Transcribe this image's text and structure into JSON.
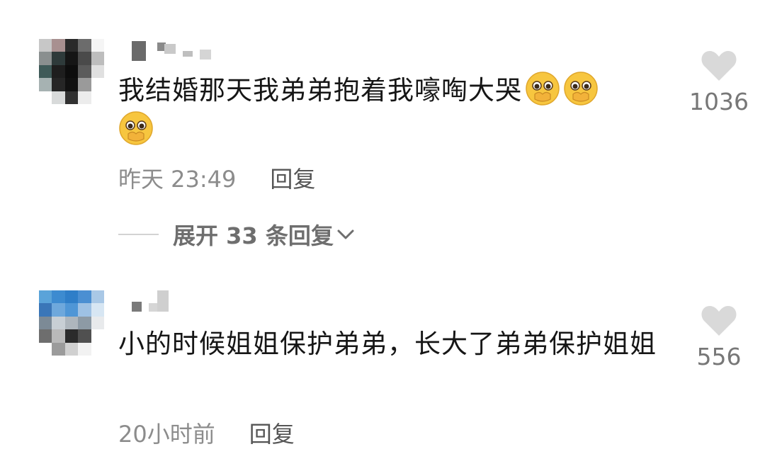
{
  "comments": [
    {
      "text": "我结婚那天我弟弟抱着我嚎啕大哭",
      "emoji": "pleading-face-icon",
      "emoji_count": 3,
      "time": "昨天 23:49",
      "reply_label": "回复",
      "likes": "1036",
      "expand_label": "展开 33 条回复"
    },
    {
      "text": "小的时候姐姐保护弟弟，长大了弟弟保护姐姐",
      "time": "20小时前",
      "reply_label": "回复",
      "likes": "556"
    }
  ],
  "colors": {
    "text": "#161616",
    "meta": "#8c8c8c",
    "heart": "#d9d9d9",
    "emoji_face": "#f7c63f"
  }
}
